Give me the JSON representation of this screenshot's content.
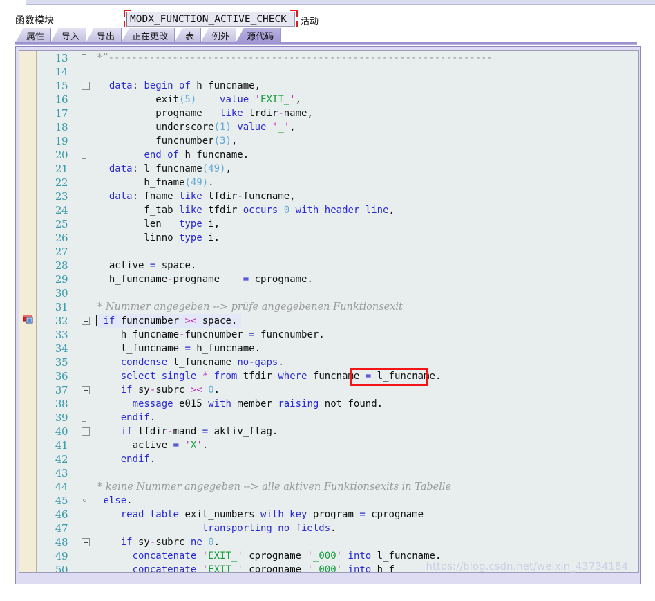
{
  "header": {
    "label": "函数模块",
    "function_name": "MODX_FUNCTION_ACTIVE_CHECK",
    "function_name_placeholder": "",
    "status": "活动"
  },
  "tabs": [
    {
      "label": "属性",
      "active": false,
      "name": "tab-attributes"
    },
    {
      "label": "导入",
      "active": false,
      "name": "tab-import"
    },
    {
      "label": "导出",
      "active": false,
      "name": "tab-export"
    },
    {
      "label": "正在更改",
      "active": false,
      "name": "tab-changing"
    },
    {
      "label": "表",
      "active": false,
      "name": "tab-tables"
    },
    {
      "label": "例外",
      "active": false,
      "name": "tab-exceptions"
    },
    {
      "label": "源代码",
      "active": true,
      "name": "tab-source-code"
    }
  ],
  "colors": {
    "accent": "#a398d4",
    "tab_border": "#9b98c4",
    "editor_bg": "#e8eeee",
    "gutter_bg": "#f3ecd6",
    "line_number": "#3a9aa8",
    "keyword": "#2b2bd4",
    "string": "#139b3c",
    "quote": "#c02fc0",
    "number": "#63a9d6",
    "comment": "#9a9a9a",
    "annotation_red": "#f21616",
    "highlight_line": "#e2e8f7"
  },
  "editor": {
    "first_visible_line": 13,
    "last_visible_line": 50,
    "current_line": 32,
    "bookmark_line": 32,
    "lines": [
      {
        "n": 13,
        "fold": "tick-top",
        "html": "<span class=\"cmt\">*</span><span class=\"dash\">&#8221;------------------------------------------------------------------</span>"
      },
      {
        "n": 14,
        "fold": "",
        "html": ""
      },
      {
        "n": 15,
        "fold": "box",
        "html": "  <span class=\"kw\">data</span>: <span class=\"kw\">begin of</span> h_funcname,"
      },
      {
        "n": 16,
        "fold": "",
        "html": "          exit<span class=\"num\">(5)</span>    <span class=\"kw\">value</span> <span class=\"q\">'</span><span class=\"str\">EXIT_</span><span class=\"q\">'</span>,"
      },
      {
        "n": 17,
        "fold": "",
        "html": "          progname   <span class=\"kw\">like</span> trdir<span class=\"op\">-</span>name,"
      },
      {
        "n": 18,
        "fold": "",
        "html": "          underscore<span class=\"num\">(1)</span> <span class=\"kw\">value</span> <span class=\"q\">'</span><span class=\"str\">_</span><span class=\"q\">'</span>,"
      },
      {
        "n": 19,
        "fold": "",
        "html": "          funcnumber<span class=\"num\">(3)</span>,"
      },
      {
        "n": 20,
        "fold": "tick-bot",
        "html": "        <span class=\"kw\">end of</span> h_funcname."
      },
      {
        "n": 21,
        "fold": "",
        "html": "  <span class=\"kw\">data</span>: l_funcname<span class=\"num\">(49)</span>,"
      },
      {
        "n": 22,
        "fold": "",
        "html": "        h_fname<span class=\"num\">(49)</span>."
      },
      {
        "n": 23,
        "fold": "",
        "html": "  <span class=\"kw\">data</span>: fname <span class=\"kw\">like</span> tfdir<span class=\"op\">-</span>funcname,"
      },
      {
        "n": 24,
        "fold": "",
        "html": "        f_tab <span class=\"kw\">like</span> tfdir <span class=\"kw\">occurs</span> <span class=\"num\">0</span> <span class=\"kw\">with header line</span>,"
      },
      {
        "n": 25,
        "fold": "",
        "html": "        len   <span class=\"kw\">type</span> i,"
      },
      {
        "n": 26,
        "fold": "",
        "html": "        linno <span class=\"kw\">type</span> i."
      },
      {
        "n": 27,
        "fold": "",
        "html": ""
      },
      {
        "n": 28,
        "fold": "",
        "html": "  active <span class=\"eq\">=</span> space."
      },
      {
        "n": 29,
        "fold": "",
        "html": "  h_funcname<span class=\"op\">-</span>progname    <span class=\"eq\">=</span> cprogname."
      },
      {
        "n": 30,
        "fold": "",
        "html": ""
      },
      {
        "n": 31,
        "fold": "",
        "html": "<span class=\"cmt\">* Nummer angegeben --&gt; pr&uuml;fe angegebenen Funktionsexit</span>"
      },
      {
        "n": 32,
        "fold": "box",
        "hl": true,
        "caret": true,
        "bookmark": true,
        "html": " <span class=\"kw\">if</span> funcnumber <span class=\"op\">&gt;&lt;</span> space."
      },
      {
        "n": 33,
        "fold": "",
        "html": "    h_funcname<span class=\"op\">-</span>funcnumber <span class=\"eq\">=</span> funcnumber."
      },
      {
        "n": 34,
        "fold": "",
        "html": "    l_funcname <span class=\"eq\">=</span> h_funcname."
      },
      {
        "n": 35,
        "fold": "",
        "html": "    <span class=\"kw\">condense</span> l_funcname <span class=\"kw\">no-gaps</span>."
      },
      {
        "n": 36,
        "fold": "",
        "html": "    <span class=\"kw\">select single</span> <span class=\"op\">*</span> <span class=\"kw\">from</span> tfdir <span class=\"kw\">where</span> funcname <span class=\"eq\">=</span> l_funcname."
      },
      {
        "n": 37,
        "fold": "box",
        "html": "    <span class=\"kw\">if</span> sy<span class=\"op\">-</span>subrc <span class=\"op\">&gt;&lt;</span> <span class=\"num\">0</span>."
      },
      {
        "n": 38,
        "fold": "",
        "html": "      <span class=\"kw\">message</span> e015 <span class=\"kw\">with</span> member <span class=\"kw\">raising</span> not_found."
      },
      {
        "n": 39,
        "fold": "tick-bot",
        "html": "    <span class=\"kw\">endif</span>."
      },
      {
        "n": 40,
        "fold": "box",
        "html": "    <span class=\"kw\">if</span> tfdir<span class=\"op\">-</span>mand <span class=\"eq\">=</span> aktiv_flag."
      },
      {
        "n": 41,
        "fold": "",
        "html": "      active <span class=\"eq\">=</span> <span class=\"q\">'</span><span class=\"str\">X</span><span class=\"q\">'</span>."
      },
      {
        "n": 42,
        "fold": "tick-bot",
        "html": "    <span class=\"kw\">endif</span>."
      },
      {
        "n": 43,
        "fold": "",
        "html": ""
      },
      {
        "n": 44,
        "fold": "",
        "html": "<span class=\"cmt\">* keine Nummer angegeben --&gt; alle aktiven Funktionsexits in Tabelle</span>"
      },
      {
        "n": 45,
        "fold": "circ",
        "html": " <span class=\"kw\">else</span>."
      },
      {
        "n": 46,
        "fold": "",
        "html": "    <span class=\"kw\">read table</span> exit_numbers <span class=\"kw\">with key</span> program <span class=\"eq\">=</span> cprogname"
      },
      {
        "n": 47,
        "fold": "",
        "html": "                  <span class=\"kw\">transporting no fields</span>."
      },
      {
        "n": 48,
        "fold": "box",
        "html": "    <span class=\"kw\">if</span> sy<span class=\"op\">-</span>subrc <span class=\"kw\">ne</span> <span class=\"num\">0</span>."
      },
      {
        "n": 49,
        "fold": "",
        "html": "      <span class=\"kw\">concatenate</span> <span class=\"q\">'</span><span class=\"str\">EXIT_</span><span class=\"q\">'</span> cprogname <span class=\"q\">'</span><span class=\"str\">_000</span><span class=\"q\">'</span> <span class=\"kw\">into</span> l_funcname."
      },
      {
        "n": 50,
        "fold": "",
        "html": "      <span class=\"kw\">concatenate</span> <span class=\"q\">'</span><span class=\"str\">EXIT_</span><span class=\"q\">'</span> cprogname <span class=\"q\">'</span><span class=\"str\">_000</span><span class=\"q\">'</span> <span class=\"kw\">into</span> h_f"
      }
    ]
  },
  "annotations": {
    "code_highlight_text": "l_funcname",
    "field_highlight_text": "MODX_FUNCTION_ACTIVE_CHECK"
  },
  "watermark": "https://blog.csdn.net/weixin_43734184"
}
